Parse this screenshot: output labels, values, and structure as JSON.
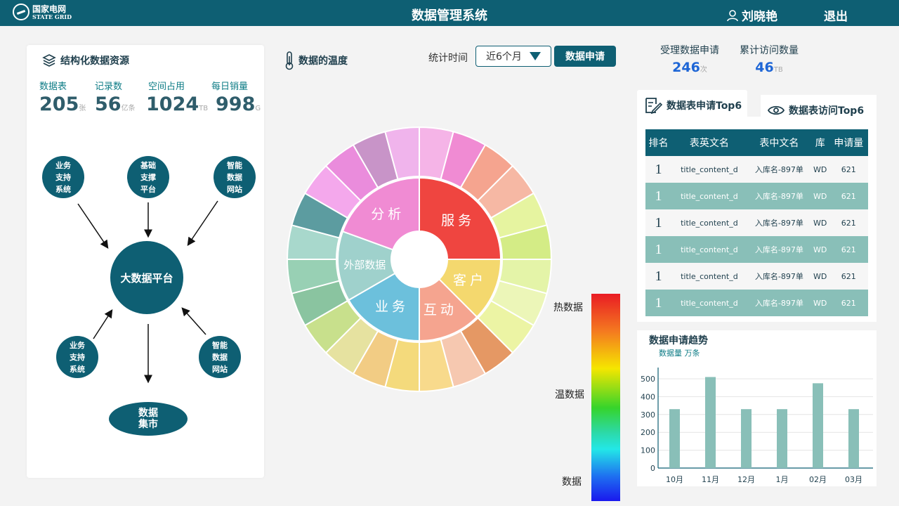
{
  "header": {
    "logo_cn": "国家电网",
    "logo_en": "STATE GRID",
    "title": "数据管理系统",
    "user": "刘晓艳",
    "logout": "退出"
  },
  "resources": {
    "title": "结构化数据资源",
    "stats": [
      {
        "label": "数据表",
        "value": "205",
        "unit": "张"
      },
      {
        "label": "记录数",
        "value": "56",
        "unit": "亿条"
      },
      {
        "label": "空间占用",
        "value": "1024",
        "unit": "TB"
      },
      {
        "label": "每日销量",
        "value": "998",
        "unit": "G"
      }
    ],
    "nodes": {
      "top_left": [
        "业务",
        "支持",
        "系统"
      ],
      "top_mid": [
        "基础",
        "支撑",
        "平台"
      ],
      "top_right": [
        "智能",
        "数据",
        "网站"
      ],
      "center": "大数据平台",
      "bottom_left": [
        "业务",
        "支持",
        "系统"
      ],
      "bottom_right": [
        "智能",
        "数据",
        "网站"
      ],
      "bottom": [
        "数据",
        "集市"
      ]
    }
  },
  "temperature": {
    "title": "数据的温度",
    "inner_labels": [
      "服务",
      "客户",
      "互动",
      "业务",
      "外部数据",
      "分析"
    ],
    "heat_labels": {
      "hot": "热数据",
      "warm": "温数据",
      "cold": "数据"
    }
  },
  "filter": {
    "label": "统计时间",
    "period": "近6个月",
    "apply": "数据申请"
  },
  "metrics": [
    {
      "label": "受理数据申请",
      "value": "246",
      "unit": "次"
    },
    {
      "label": "累计访问数量",
      "value": "46",
      "unit": "TB"
    }
  ],
  "top6": {
    "tab_apply": "数据表申请Top6",
    "tab_visit": "数据表访问Top6",
    "columns": [
      "排名",
      "表英文名",
      "表中文名",
      "库",
      "申请量"
    ],
    "rows": [
      {
        "rank": "1",
        "en": "title_content_d",
        "cn": "入库名-897单",
        "db": "WD",
        "count": "621"
      },
      {
        "rank": "1",
        "en": "title_content_d",
        "cn": "入库名-897单",
        "db": "WD",
        "count": "621"
      },
      {
        "rank": "1",
        "en": "title_content_d",
        "cn": "入库名-897单",
        "db": "WD",
        "count": "621"
      },
      {
        "rank": "1",
        "en": "title_content_d",
        "cn": "入库名-897单",
        "db": "WD",
        "count": "621"
      },
      {
        "rank": "1",
        "en": "title_content_d",
        "cn": "入库名-897单",
        "db": "WD",
        "count": "621"
      },
      {
        "rank": "1",
        "en": "title_content_d",
        "cn": "入库名-897单",
        "db": "WD",
        "count": "621"
      }
    ]
  },
  "chart_data": {
    "type": "bar",
    "title": "数据申请趋势",
    "subtitle": "数据量 万条",
    "categories": [
      "10月",
      "11月",
      "12月",
      "1月",
      "02月",
      "03月"
    ],
    "values": [
      330,
      510,
      330,
      330,
      475,
      330
    ],
    "ylim": [
      0,
      500
    ],
    "yticks": [
      0,
      100,
      200,
      300,
      400,
      500
    ],
    "grid": true,
    "color": "#89bfb8"
  },
  "colors": {
    "primary": "#0e5f73",
    "accent_teal": "#89bfb8",
    "metric_blue": "#1e66d6"
  }
}
